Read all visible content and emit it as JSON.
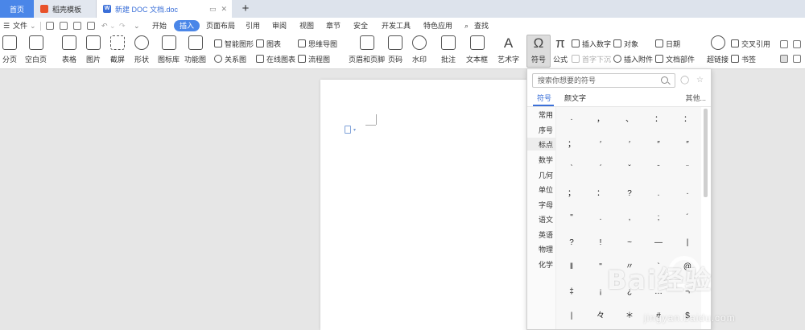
{
  "tabs": {
    "home": "首页",
    "template": "稻壳模板",
    "doc": "新建 DOC 文档.doc",
    "new_tab": "+"
  },
  "menubar": {
    "file": "文件",
    "items": [
      "开始",
      "插入",
      "页面布局",
      "引用",
      "审阅",
      "视图",
      "章节",
      "安全",
      "开发工具",
      "特色应用"
    ],
    "active_item": "插入",
    "search": "查找"
  },
  "ribbon": {
    "page_break": "分页",
    "blank_page": "空白页",
    "table": "表格",
    "picture": "图片",
    "screenshot": "截屏",
    "shape": "形状",
    "icon_library": "图标库",
    "function_chart": "功能图",
    "smart_graphic": "智能图形",
    "chart": "图表",
    "mind_map": "思维导图",
    "relation_chart": "关系图",
    "online_chart": "在线图表",
    "flowchart": "流程图",
    "header_footer": "页眉和页脚",
    "page_number": "页码",
    "watermark": "水印",
    "comment": "批注",
    "textbox": "文本框",
    "art_text": "艺术字",
    "symbol": "符号",
    "formula": "公式",
    "insert_number": "插入数字",
    "first_sink": "首字下沉",
    "object": "对象",
    "insert_attachment": "插入附件",
    "date": "日期",
    "doc_parts": "文档部件",
    "hyperlink": "超链接",
    "cross_ref": "交叉引用",
    "bookmark": "书签"
  },
  "symbol_panel": {
    "search_placeholder": "搜索你想要的符号",
    "tab_symbol": "符号",
    "tab_emoticon": "颜文字",
    "more": "其他...",
    "categories": [
      "常用",
      "序号",
      "标点",
      "数学",
      "几何",
      "单位",
      "字母",
      "语文",
      "英语",
      "物理",
      "化学"
    ],
    "active_category": "标点",
    "symbols": [
      [
        "·",
        "，",
        "、",
        "：",
        "："
      ],
      [
        "；",
        "′",
        "′",
        "″",
        "″"
      ],
      [
        "ˋ",
        "ˊ",
        "ˇ",
        "ˉ",
        "¨"
      ],
      [
        "；",
        "：",
        "?",
        ".",
        "·"
      ],
      [
        "\"",
        ".",
        ",",
        ";",
        "´"
      ],
      [
        "?",
        "!",
        "~",
        "—",
        "|"
      ],
      [
        "‖",
        "\"",
        "〃",
        "`",
        "@"
      ],
      [
        "‡",
        "¡",
        "¿",
        "…",
        "¬"
      ],
      [
        "|",
        "々",
        "＊",
        "#",
        "$"
      ]
    ]
  },
  "watermark": {
    "brand": "Bai经验",
    "url": "jingyan.baidu.com"
  }
}
